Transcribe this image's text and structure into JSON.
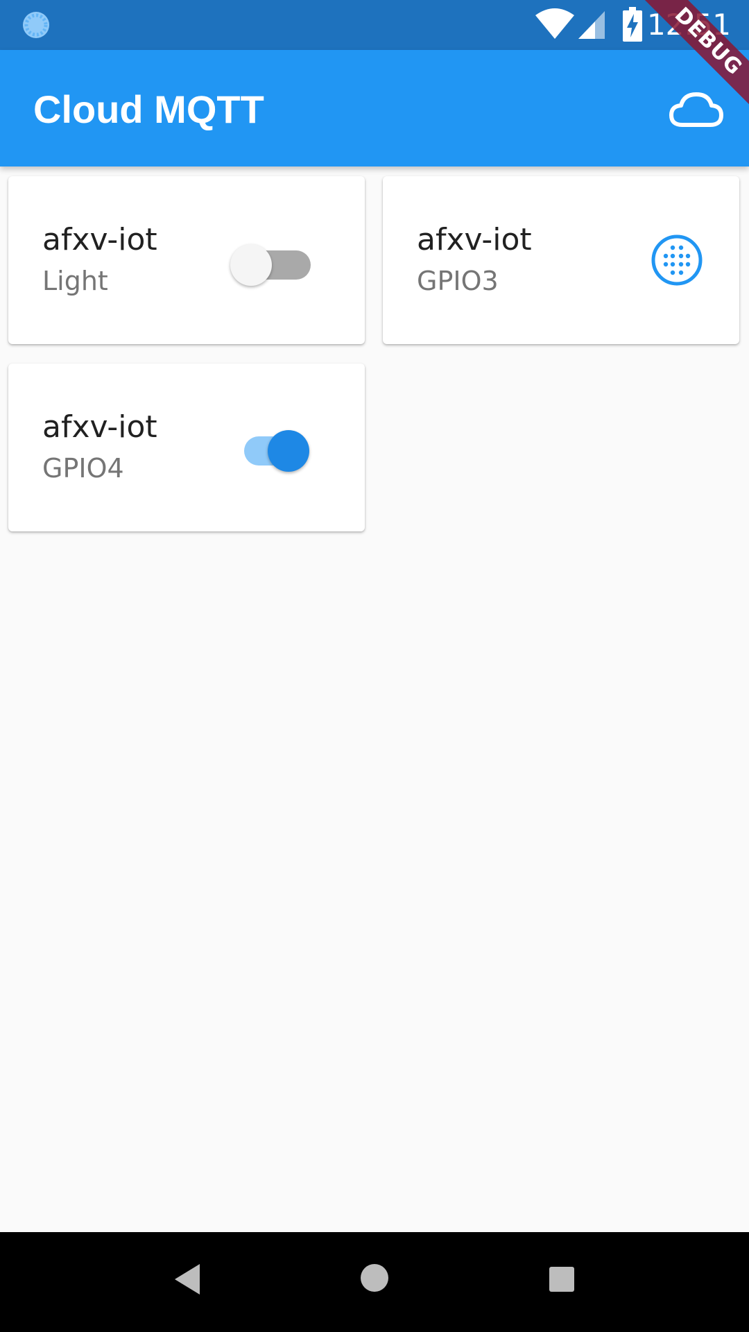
{
  "status_bar": {
    "time": "12:51",
    "icons": [
      "loading-icon",
      "wifi-icon",
      "signal-icon",
      "battery-charging-icon"
    ],
    "color": "#1e72be"
  },
  "app_bar": {
    "title": "Cloud MQTT",
    "action_icon": "cloud-icon",
    "color": "#2196f3"
  },
  "debug_banner": "DEBUG",
  "cards": [
    {
      "title": "afxv-iot",
      "subtitle": "Light",
      "control": "switch",
      "on": false
    },
    {
      "title": "afxv-iot",
      "subtitle": "GPIO3",
      "control": "dialpad-icon-button",
      "icon_color": "#2196f3"
    },
    {
      "title": "afxv-iot",
      "subtitle": "GPIO4",
      "control": "switch",
      "on": true
    }
  ],
  "nav_bar": {
    "buttons": [
      "back-icon",
      "home-icon",
      "recents-icon"
    ]
  }
}
